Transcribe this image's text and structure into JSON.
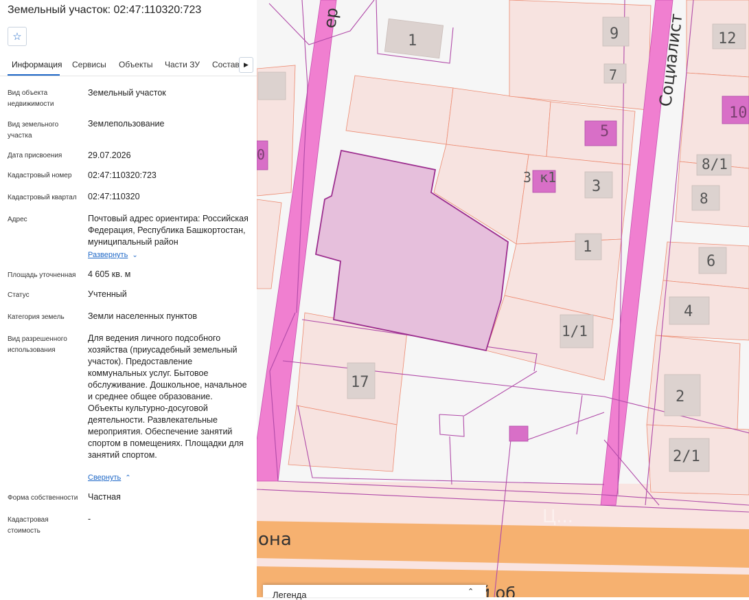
{
  "header": {
    "title": "Земельный участок: 02:47:110320:723",
    "favorite_icon": "star-icon"
  },
  "tabs": [
    {
      "label": "Информация",
      "active": true
    },
    {
      "label": "Сервисы",
      "active": false
    },
    {
      "label": "Объекты",
      "active": false
    },
    {
      "label": "Части ЗУ",
      "active": false
    },
    {
      "label": "Состав",
      "active": false
    }
  ],
  "tabs_next_icon": "chevron-right-icon",
  "fields": [
    {
      "label": "Вид объекта недвижимости",
      "value": "Земельный участок"
    },
    {
      "label": "Вид земельного участка",
      "value": "Землепользование"
    },
    {
      "label": "Дата присвоения",
      "value": "29.07.2026"
    },
    {
      "label": "Кадастровый номер",
      "value": "02:47:110320:723"
    },
    {
      "label": "Кадастровый квартал",
      "value": "02:47:110320"
    },
    {
      "label": "Адрес",
      "value": "Почтовый адрес ориентира: Российская Федерация, Республика Башкортостан, муниципальный район"
    },
    {
      "label": "Площадь уточненная",
      "value": "4 605 кв. м"
    },
    {
      "label": "Статус",
      "value": "Учтенный"
    },
    {
      "label": "Категория земель",
      "value": "Земли населенных пунктов"
    },
    {
      "label": "Вид разрешенного использования",
      "value": "Для ведения личного подсобного хозяйства (приусадебный земельный участок). Предоставление коммунальных услуг. Бытовое обслуживание. Дошкольное, начальное и среднее общее образование. Объекты культурно-досуговой деятельности. Развлекательные мероприятия. Обеспечение занятий спортом в помещениях. Площадки для занятий спортом."
    },
    {
      "label": "Форма собственности",
      "value": "Частная"
    },
    {
      "label": "Кадастровая стоимость",
      "value": "-"
    }
  ],
  "links": {
    "expand": "Развернуть",
    "collapse": "Свернуть"
  },
  "map": {
    "street_left": "ер",
    "street_right": "Социалист",
    "street_bottom": "она",
    "street_bottom2": "й об",
    "watermark": "Ц...",
    "building_numbers": {
      "b1": "1",
      "b9": "9",
      "b12": "12",
      "b7": "7",
      "b5": "5",
      "b10": "10",
      "b3k1": "3 к1",
      "b3": "3",
      "b81": "8/1",
      "b8": "8",
      "b1b": "1",
      "b6": "6",
      "b4": "4",
      "b11": "1/1",
      "b17": "17",
      "b2": "2",
      "b21": "2/1",
      "b0": "0"
    },
    "colors": {
      "parcel_fill": "#e6bfdc",
      "parcel_stroke": "#9c2d8e",
      "street_pink": "#f07fd0",
      "road_orange": "#f6b170",
      "lot_fill": "#f7e3e0",
      "building": "#dcd2cf",
      "building_pink": "#d86fc7"
    }
  },
  "legend": {
    "label": "Легенда",
    "toggle_icon": "chevron-up-icon"
  }
}
